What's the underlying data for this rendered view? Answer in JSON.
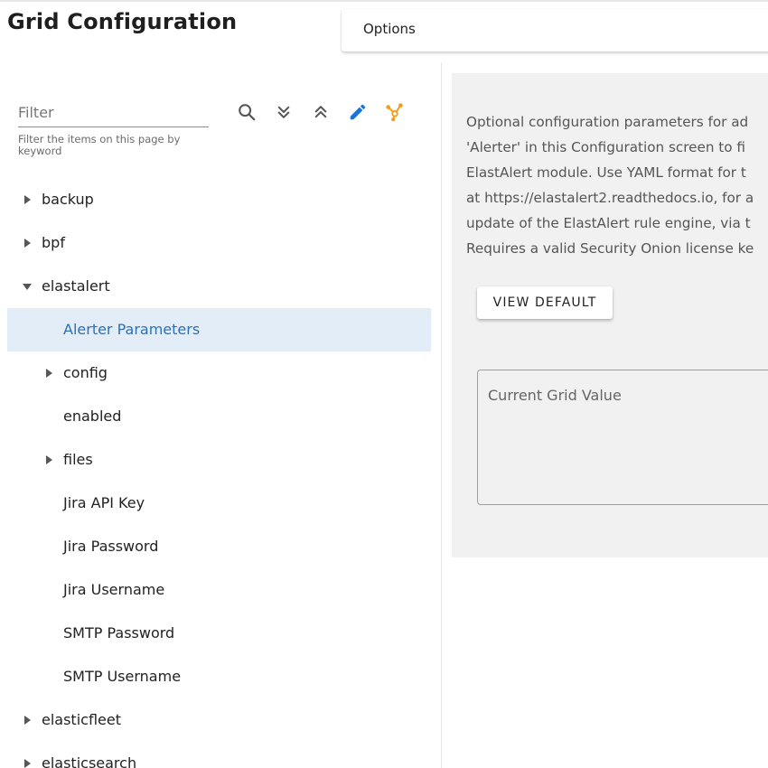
{
  "page": {
    "title": "Grid Configuration"
  },
  "options": {
    "label": "Options"
  },
  "filter": {
    "placeholder": "Filter",
    "value": "",
    "hint": "Filter the items on this page by keyword"
  },
  "toolbar": {
    "search_icon": "search-icon",
    "expand_all_icon": "chevron-double-down-icon",
    "collapse_all_icon": "chevron-double-up-icon",
    "edit_icon": "pencil-icon",
    "advanced_icon": "graph-nodes-icon",
    "colors": {
      "edit": "#1a73d9",
      "advanced": "#f29a1a"
    }
  },
  "tree": {
    "backup": "backup",
    "bpf": "bpf",
    "elastalert": "elastalert",
    "alerter_parameters": "Alerter Parameters",
    "config": "config",
    "enabled": "enabled",
    "files": "files",
    "jira_api_key": "Jira API Key",
    "jira_password": "Jira Password",
    "jira_username": "Jira Username",
    "smtp_password": "SMTP Password",
    "smtp_username": "SMTP Username",
    "elasticfleet": "elasticfleet",
    "elasticsearch": "elasticsearch"
  },
  "details": {
    "desc_lines": [
      "Optional configuration parameters for ad",
      "'Alerter' in this Configuration screen to fi",
      "ElastAlert module. Use YAML format for t",
      "at https://elastalert2.readthedocs.io, for a",
      "update of the ElastAlert rule engine, via t",
      "Requires a valid Security Onion license ke"
    ],
    "view_default_label": "VIEW DEFAULT",
    "grid_value_placeholder": "Current Grid Value"
  },
  "colors": {
    "selected_bg": "#e3edf8",
    "selected_text": "#2d70b3",
    "panel_bg": "#f1f1f1"
  }
}
